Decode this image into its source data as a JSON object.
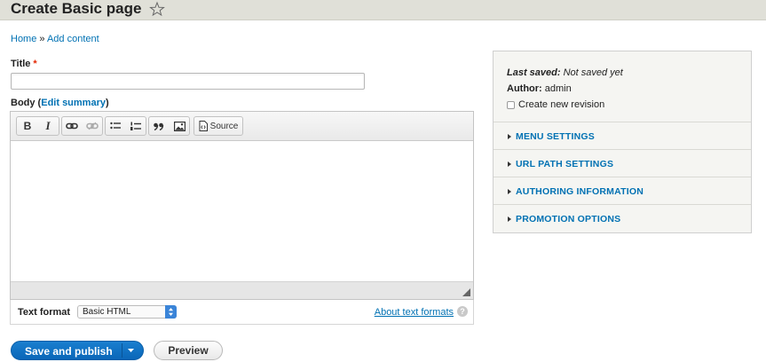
{
  "header": {
    "title": "Create Basic page",
    "shortcut_icon": "star-outline-icon"
  },
  "breadcrumb": {
    "items": [
      "Home",
      "Add content"
    ],
    "separator": " » "
  },
  "form": {
    "title_label": "Title",
    "required_marker": "*",
    "title_value": "",
    "body_label": "Body",
    "body_paren_open": " (",
    "edit_summary_link": "Edit summary",
    "body_paren_close": ")",
    "toolbar": {
      "bold": "B",
      "italic": "I",
      "source": "Source",
      "icons": [
        "bold-icon",
        "italic-icon",
        "link-icon",
        "unlink-icon",
        "bulleted-list-icon",
        "numbered-list-icon",
        "blockquote-icon",
        "image-icon",
        "source-icon"
      ]
    },
    "text_format_label": "Text format",
    "text_format_value": "Basic HTML",
    "about_text_formats": "About text formats",
    "help_glyph": "?"
  },
  "actions": {
    "save_publish": "Save and publish",
    "preview": "Preview"
  },
  "sidebar": {
    "last_saved_label": "Last saved:",
    "last_saved_value": "Not saved yet",
    "author_label": "Author:",
    "author_value": "admin",
    "revision_label": "Create new revision",
    "revision_checked": false,
    "sections": [
      "MENU SETTINGS",
      "URL PATH SETTINGS",
      "AUTHORING INFORMATION",
      "PROMOTION OPTIONS"
    ]
  },
  "colors": {
    "link": "#0071b3",
    "primary_button": "#0a66b8",
    "header_bg": "#e0e0d8",
    "required": "#e32700"
  }
}
